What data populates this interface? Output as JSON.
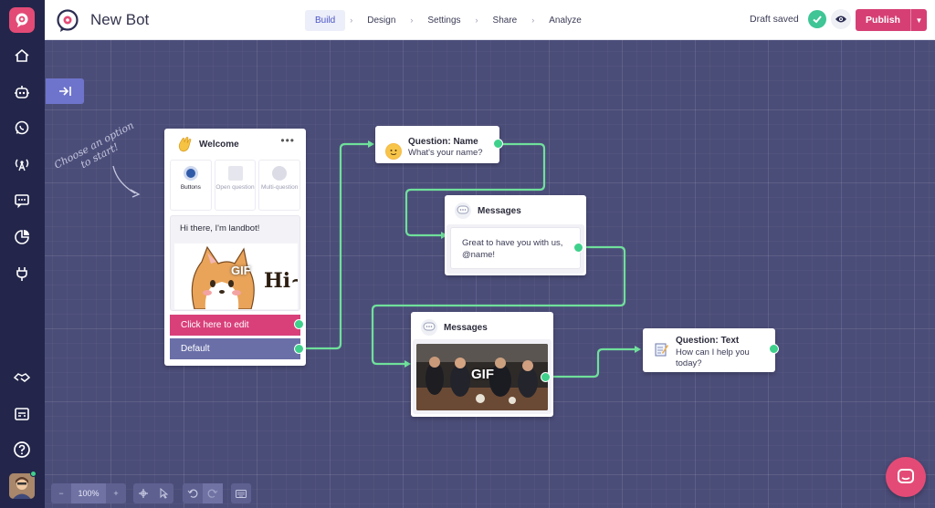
{
  "app": {
    "title": "New Bot",
    "status": "Draft saved",
    "publish_label": "Publish"
  },
  "steps": [
    {
      "label": "Build",
      "active": true
    },
    {
      "label": "Design",
      "active": false
    },
    {
      "label": "Settings",
      "active": false
    },
    {
      "label": "Share",
      "active": false
    },
    {
      "label": "Analyze",
      "active": false
    }
  ],
  "rail": {
    "icons": [
      "landbot-logo-icon",
      "home-icon",
      "bot-icon",
      "whatsapp-icon",
      "broadcast-icon",
      "chat-icon",
      "analytics-icon",
      "plug-icon",
      "handshake-icon",
      "billing-icon",
      "help-icon"
    ]
  },
  "canvas": {
    "hint": "Choose an option to start!"
  },
  "welcome": {
    "title": "Welcome",
    "options": [
      "Buttons",
      "Open question",
      "Multi-question"
    ],
    "message": "Hi there, I'm landbot!",
    "gif_label": "GIF",
    "gif_caption": "Hi~",
    "buttons": [
      "Click here to edit",
      "Default"
    ]
  },
  "question_name": {
    "title": "Question: Name",
    "text": "What's your name?"
  },
  "messages_1": {
    "title": "Messages",
    "text": "Great to have you with us, @name!"
  },
  "messages_2": {
    "title": "Messages",
    "gif_label": "GIF"
  },
  "question_text": {
    "title": "Question: Text",
    "text": "How can I help you today?"
  },
  "toolbar": {
    "zoom": "100%",
    "minus": "−",
    "plus": "+"
  },
  "colors": {
    "accent": "#d63f74",
    "connector": "#6fe09b",
    "canvas": "#4b4d79",
    "rail": "#23264a"
  }
}
